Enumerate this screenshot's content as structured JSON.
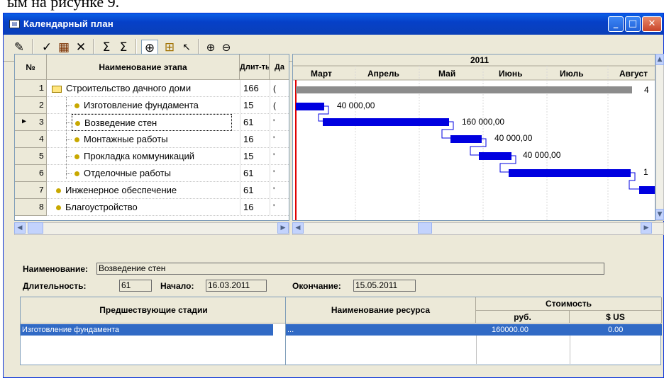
{
  "page_header_fragment": "ым на рисунке 9.",
  "window": {
    "title": "Календарный план",
    "controls": {
      "minimize": "_",
      "maximize": "□",
      "close": "✕"
    }
  },
  "toolbar": {
    "icons": [
      "properties-icon",
      "checkmark-icon",
      "resource-icon",
      "delete-icon",
      "sum-forward-icon",
      "sum-backward-icon",
      "add-node-icon",
      "tree-icon",
      "pointer-icon",
      "zoom-in-icon",
      "zoom-out-icon"
    ]
  },
  "grid": {
    "headers": {
      "num": "№",
      "name": "Наименование этапа",
      "duration": "Длит-ть",
      "start": "Да"
    },
    "rows": [
      {
        "num": "1",
        "name": "Строительство дачного доми",
        "duration": "166",
        "start": "("
      },
      {
        "num": "2",
        "name": "Изготовление фундамента",
        "duration": "15",
        "start": "("
      },
      {
        "num": "3",
        "name": "Возведение стен",
        "duration": "61",
        "start": "'"
      },
      {
        "num": "4",
        "name": "Монтажные работы",
        "duration": "16",
        "start": "'"
      },
      {
        "num": "5",
        "name": "Прокладка коммуникаций",
        "duration": "15",
        "start": "'"
      },
      {
        "num": "6",
        "name": "Отделочные работы",
        "duration": "61",
        "start": "'"
      },
      {
        "num": "7",
        "name": "Инженерное обеспечение",
        "duration": "61",
        "start": "'"
      },
      {
        "num": "8",
        "name": "Благоустройство",
        "duration": "16",
        "start": "'"
      }
    ],
    "current_row_marker": "▶"
  },
  "gantt": {
    "year": "2011",
    "months": [
      "Март",
      "Апрель",
      "Май",
      "Июнь",
      "Июль",
      "Август"
    ],
    "bar_labels": {
      "row1": "4",
      "row2": "40 000,00",
      "row3": "160 000,00",
      "row4": "40 000,00",
      "row5": "40 000,00",
      "row6": "1"
    },
    "colors": {
      "task": "#0000e0",
      "summary": "#8c8c8c",
      "today_line": "#e00000"
    }
  },
  "detail": {
    "name_label": "Наименование:",
    "name_value": "Возведение стен",
    "duration_label": "Длительность:",
    "duration_value": "61",
    "start_label": "Начало:",
    "start_value": "16.03.2011",
    "end_label": "Окончание:",
    "end_value": "15.05.2011"
  },
  "predecessors": {
    "header": "Предшествующие стадии",
    "rows": [
      "Изготовление фундамента"
    ]
  },
  "resources": {
    "header_name": "Наименование ресурса",
    "header_cost": "Стоимость",
    "header_rub": "руб.",
    "header_usd": "$ US",
    "rows": [
      {
        "name": "...",
        "rub": "160000.00",
        "usd": "0.00"
      }
    ]
  },
  "colors": {
    "title_bar": "#0a5fe6",
    "selection": "#316ac5",
    "window_bg": "#ece9d8"
  }
}
